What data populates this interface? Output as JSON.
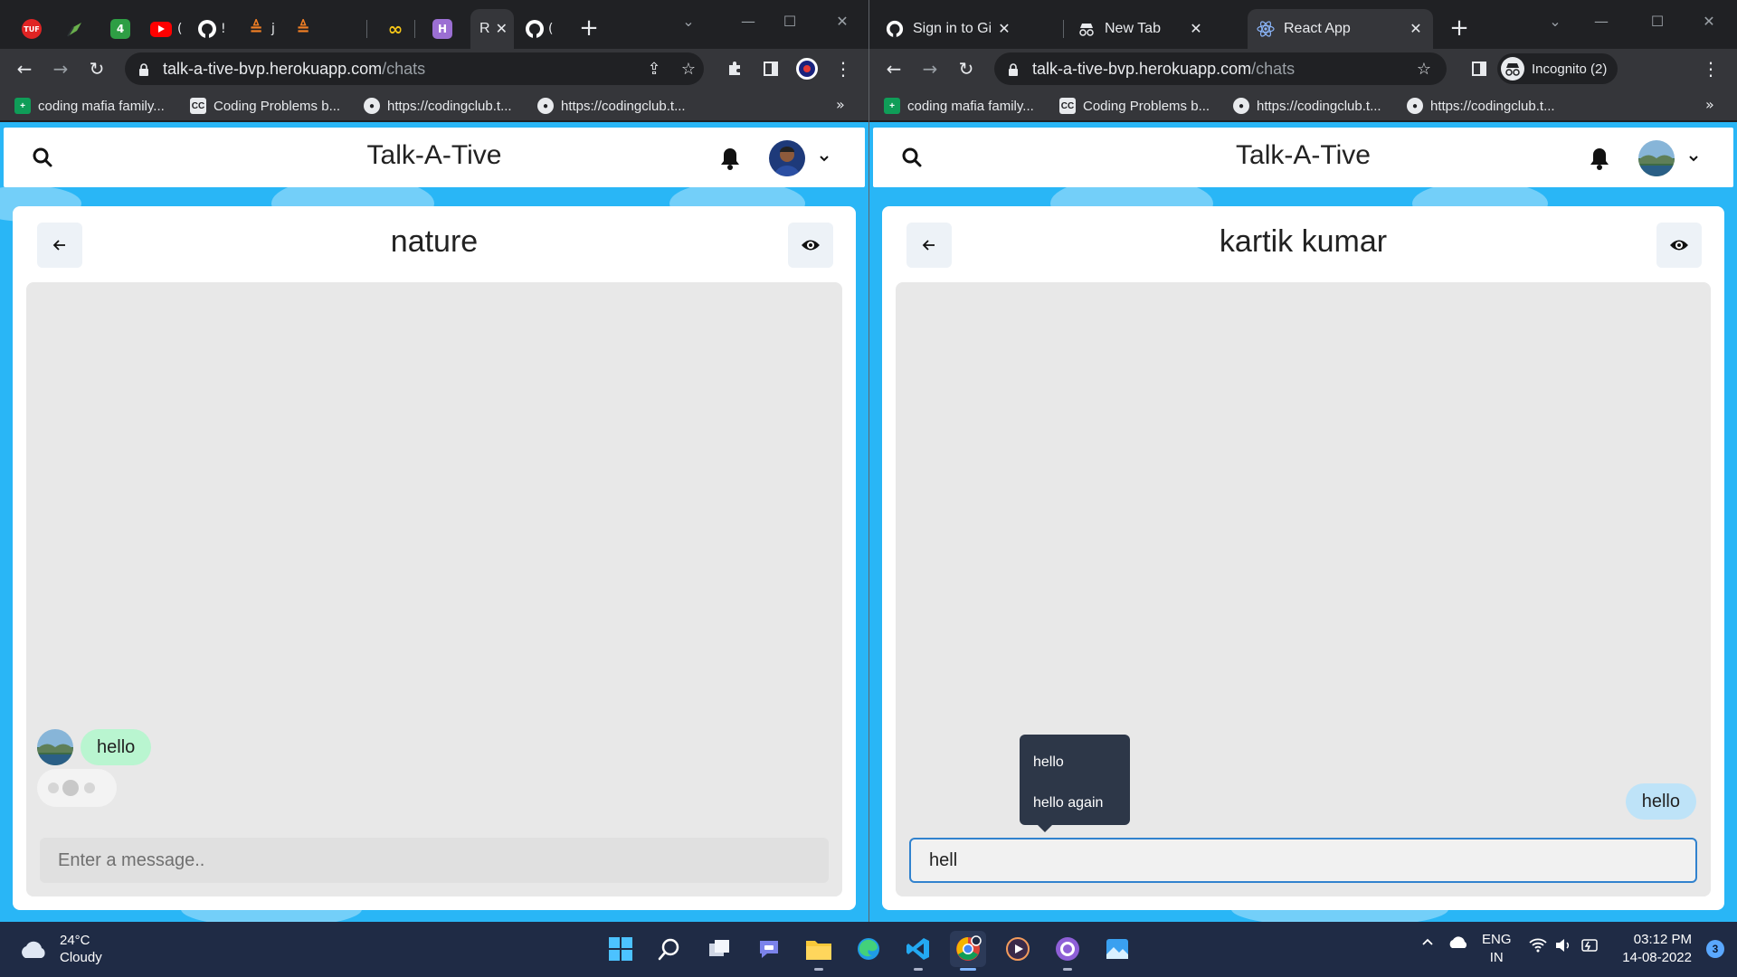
{
  "left_window": {
    "tabs": [
      {
        "icon": "tuf-icon",
        "label": ""
      },
      {
        "icon": "pen-icon",
        "label": ""
      },
      {
        "icon": "number-four-icon",
        "label": "4"
      },
      {
        "icon": "youtube-icon",
        "label": "("
      },
      {
        "icon": "github-icon",
        "label": "!"
      },
      {
        "icon": "stackoverflow-icon",
        "label": "j"
      },
      {
        "icon": "stackoverflow-icon",
        "label": ""
      },
      {
        "icon": "blank-icon",
        "label": ""
      },
      {
        "icon": "infinity-icon",
        "label": ""
      },
      {
        "icon": "h-logo-icon",
        "label": ""
      },
      {
        "icon": "react-icon",
        "label": "R"
      },
      {
        "icon": "github-icon",
        "label": "("
      }
    ],
    "active_tab_label": "R",
    "address": {
      "host": "talk-a-tive-bvp.herokuapp.com",
      "path": "/chats"
    },
    "bookmarks": [
      {
        "icon": "sheets-icon",
        "label": "coding mafia family..."
      },
      {
        "icon": "cc-icon",
        "label": "Coding Problems b..."
      },
      {
        "icon": "bulb-icon",
        "label": "https://codingclub.t..."
      },
      {
        "icon": "bulb-icon",
        "label": "https://codingclub.t..."
      }
    ],
    "bookmarks_more": "»",
    "app": {
      "brand": "Talk-A-Tive",
      "chat_title": "nature",
      "messages": [
        {
          "text": "hello",
          "side": "left",
          "color": "#b9f5d0"
        }
      ],
      "typing_indicator": true,
      "input": {
        "value": "",
        "placeholder": "Enter a message.."
      }
    }
  },
  "right_window": {
    "tabs": [
      {
        "icon": "github-icon",
        "label": "Sign in to GitHub ·"
      },
      {
        "icon": "incognito-icon",
        "label": "New Tab"
      },
      {
        "icon": "react-icon",
        "label": "React App"
      }
    ],
    "address": {
      "host": "talk-a-tive-bvp.herokuapp.com",
      "path": "/chats"
    },
    "incognito_label": "Incognito (2)",
    "bookmarks": [
      {
        "icon": "sheets-icon",
        "label": "coding mafia family..."
      },
      {
        "icon": "cc-icon",
        "label": "Coding Problems b..."
      },
      {
        "icon": "bulb-icon",
        "label": "https://codingclub.t..."
      },
      {
        "icon": "bulb-icon",
        "label": "https://codingclub.t..."
      }
    ],
    "bookmarks_more": "»",
    "app": {
      "brand": "Talk-A-Tive",
      "chat_title": "kartik kumar",
      "messages": [
        {
          "text": "hello",
          "side": "right",
          "color": "#bee3f8"
        }
      ],
      "suggestions": [
        "hello",
        "hello again"
      ],
      "input": {
        "value": "hell",
        "placeholder": "Enter a message.."
      }
    }
  },
  "taskbar": {
    "weather": {
      "temp": "24°C",
      "condition": "Cloudy"
    },
    "apps": [
      "windows-start-icon",
      "search-icon",
      "task-view-icon",
      "teams-chat-icon",
      "file-explorer-icon",
      "edge-icon",
      "vscode-icon",
      "chrome-icon",
      "media-player-icon",
      "github-desktop-icon",
      "photos-icon"
    ],
    "language": {
      "line1": "ENG",
      "line2": "IN"
    },
    "time": "03:12 PM",
    "date": "14-08-2022",
    "notifications": "3"
  },
  "colors": {
    "app_background": "#29b6f6",
    "chrome_dark": "#202124",
    "chrome_toolbar": "#35363a",
    "taskbar": "#1f2b45",
    "left_bubble": "#b9f5d0",
    "right_bubble": "#bee3f8",
    "input_focus": "#3182ce"
  }
}
